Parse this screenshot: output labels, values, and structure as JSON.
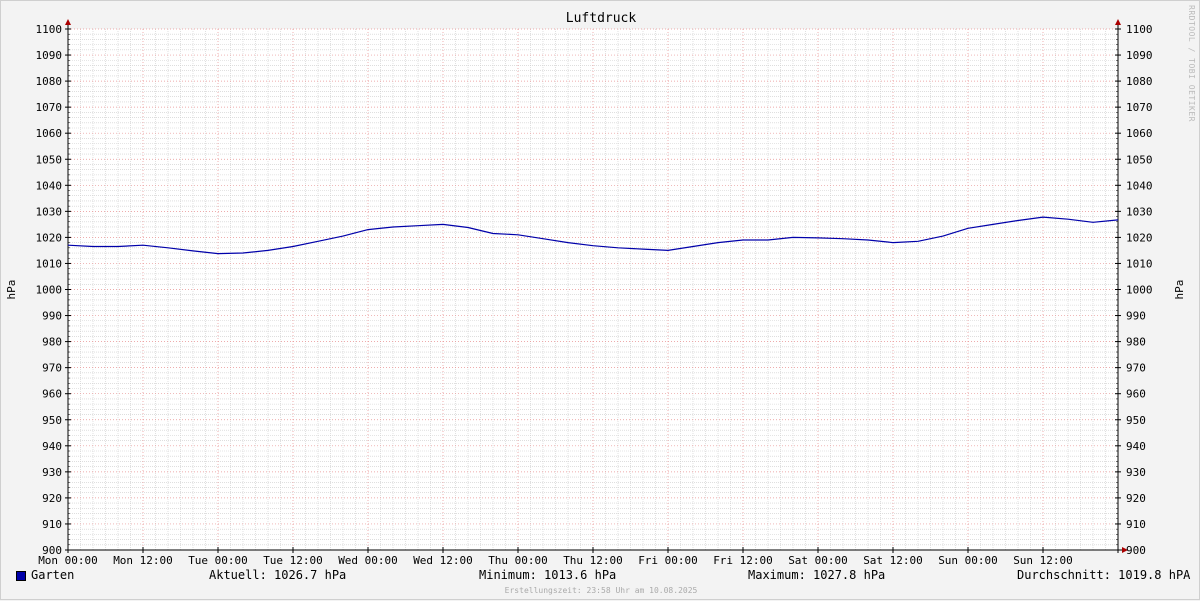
{
  "chart_data": {
    "type": "line",
    "title": "Luftdruck",
    "ylabel": "hPa",
    "ylabel_right": "hPa",
    "ylim": [
      900,
      1100
    ],
    "y_ticks": [
      900,
      910,
      920,
      930,
      940,
      950,
      960,
      970,
      980,
      990,
      1000,
      1010,
      1020,
      1030,
      1040,
      1050,
      1060,
      1070,
      1080,
      1090,
      1100
    ],
    "x_ticks": [
      "Mon 00:00",
      "Mon 12:00",
      "Tue 00:00",
      "Tue 12:00",
      "Wed 00:00",
      "Wed 12:00",
      "Thu 00:00",
      "Thu 12:00",
      "Fri 00:00",
      "Fri 12:00",
      "Sat 00:00",
      "Sat 12:00",
      "Sun 00:00",
      "Sun 12:00"
    ],
    "xlim_hours": [
      0,
      168
    ],
    "grid": true,
    "series": [
      {
        "name": "Garten",
        "color": "#0000aa",
        "x_hours": [
          0,
          4,
          8,
          12,
          16,
          20,
          24,
          28,
          32,
          36,
          40,
          44,
          48,
          52,
          56,
          60,
          64,
          68,
          72,
          76,
          80,
          84,
          88,
          92,
          96,
          100,
          104,
          108,
          112,
          116,
          120,
          124,
          128,
          132,
          136,
          140,
          144,
          148,
          152,
          156,
          160,
          164,
          168
        ],
        "values": [
          1017,
          1016.5,
          1016.5,
          1017,
          1016,
          1014.8,
          1013.8,
          1014,
          1015,
          1016.5,
          1018.5,
          1020.5,
          1023,
          1024,
          1024.5,
          1025,
          1023.8,
          1021.5,
          1021,
          1019.5,
          1018,
          1016.8,
          1016,
          1015.5,
          1015,
          1016.5,
          1018,
          1019,
          1019,
          1020,
          1019.8,
          1019.5,
          1019,
          1018,
          1018.5,
          1020.5,
          1023.5,
          1025,
          1026.5,
          1027.8,
          1027,
          1025.8,
          1026.7
        ]
      }
    ]
  },
  "legend": {
    "series_label": "Garten",
    "current": "Aktuell: 1026.7 hPa",
    "minimum": "Minimum: 1013.6 hPa",
    "maximum": "Maximum: 1027.8 hPa",
    "average": "Durchschnitt: 1019.8 hPA"
  },
  "footer": "Erstellungszeit: 23:58 Uhr am 10.08.2025",
  "watermark": "RRDTOOL / TOBI OETIKER",
  "colors": {
    "background": "#f3f3f3",
    "plot_background": "#ffffff",
    "major_grid": "#e89090",
    "minor_grid": "#cccccc",
    "line": "#0000aa",
    "arrow": "#aa0000"
  }
}
